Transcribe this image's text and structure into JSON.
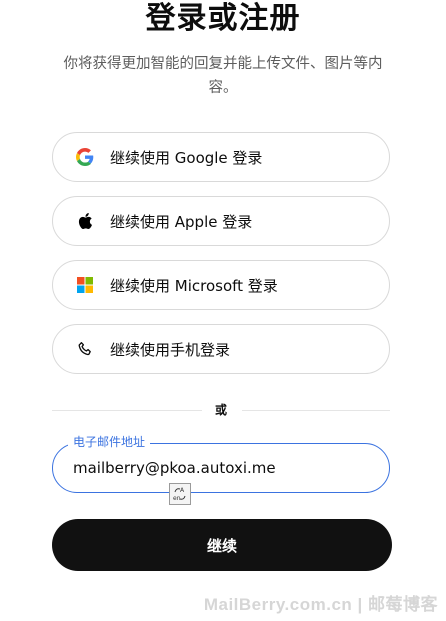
{
  "header": {
    "title": "登录或注册",
    "subtitle": "你将获得更加智能的回复并能上传文件、图片等内容。"
  },
  "auth_options": [
    {
      "label": "继续使用 Google 登录",
      "icon": "google-icon"
    },
    {
      "label": "继续使用 Apple 登录",
      "icon": "apple-icon"
    },
    {
      "label": "继续使用 Microsoft 登录",
      "icon": "microsoft-icon"
    },
    {
      "label": "继续使用手机登录",
      "icon": "phone-icon"
    }
  ],
  "divider": {
    "text": "或"
  },
  "email": {
    "label": "电子邮件地址",
    "value": "mailberry@pkoa.autoxi.me"
  },
  "continue_button": {
    "label": "继续"
  },
  "watermark": {
    "text": "MailBerry.com.cn | 邮莓博客"
  },
  "colors": {
    "accent": "#3b73e0",
    "primary_button": "#111111"
  }
}
